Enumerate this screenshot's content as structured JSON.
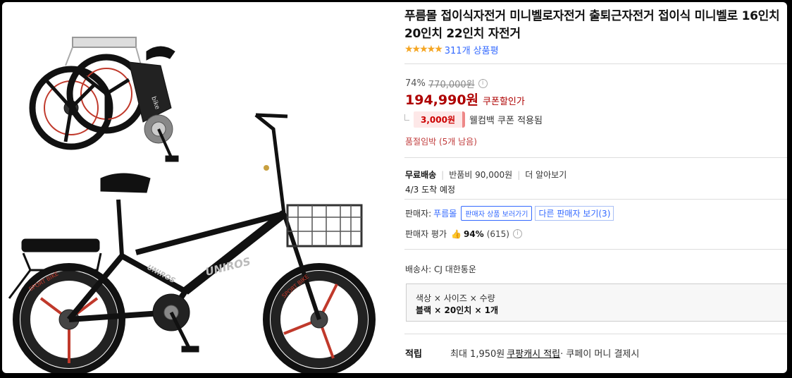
{
  "product": {
    "title": "푸름몰 접이식자전거 미니벨로자전거 출퇴근자전거 접이식 미니벨로 16인치 20인치 22인치 자전거",
    "stars": "★★★★★",
    "review_count": "311개 상품평",
    "rating": 4.5
  },
  "price": {
    "discount_rate": "74%",
    "original_price": "770,000원",
    "info_icon": "i",
    "sale_price": "194,990원",
    "coupon_label": "쿠폰할인가",
    "coupon_amount": "3,000원",
    "coupon_text": "웰컴백 쿠폰 적용됨",
    "stock_warning": "품절임박 (5개 남음)"
  },
  "shipping": {
    "free": "무료배송",
    "return_fee": "반품비 90,000원",
    "more": "더 알아보기",
    "arrival": "4/3 도착 예정"
  },
  "seller": {
    "label": "판매자: ",
    "name": "푸름몰",
    "view_products_button": "판매자 상품 보러가기",
    "other_sellers": "다른 판매자 보기(3)",
    "rating_label": "판매자 평가",
    "thumb_icon": "👍",
    "rating_pct": "94%",
    "rating_count": "(615)"
  },
  "carrier": "배송사: CJ 대한통운",
  "options": {
    "header": "색상 × 사이즈 × 수량",
    "selected": "블랙 × 20인치 × 1개"
  },
  "reward": {
    "label": "적립",
    "amount_text": "최대 1,950원",
    "link_text": "쿠팡캐시 적립",
    "suffix": " · 쿠페이 머니 결제시"
  },
  "image": {
    "frame_brand": "bike",
    "frame_text": "UNIROS",
    "wheel_text": "SPORT BIKE"
  },
  "colors": {
    "price_red": "#ae0000",
    "link_blue": "#346aff",
    "star_gold": "#f5a623"
  }
}
